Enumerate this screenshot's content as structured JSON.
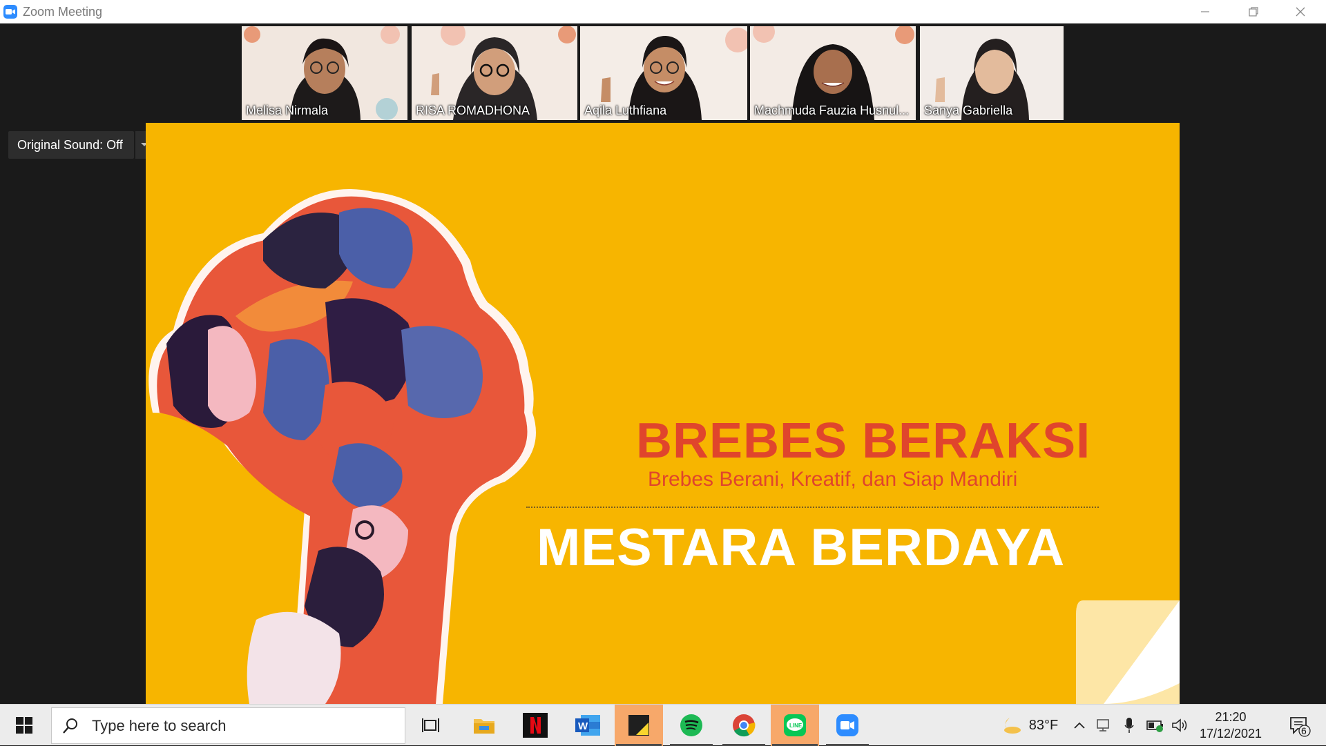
{
  "window": {
    "title": "Zoom Meeting"
  },
  "participants": [
    {
      "name": "Melisa Nirmala",
      "active": false
    },
    {
      "name": "RISA ROMADHONA",
      "active": false
    },
    {
      "name": "Aqila Luthfiana",
      "active": true
    },
    {
      "name": "Machmuda Fauzia Husnul...",
      "active": false
    },
    {
      "name": "Sanya Gabriella",
      "active": false
    }
  ],
  "audio": {
    "original_sound_label": "Original Sound: Off"
  },
  "slide": {
    "headline": "BREBES BERAKSI",
    "tagline": "Brebes Berani, Kreatif, dan Siap Mandiri",
    "program": "MESTARA BERDAYA"
  },
  "taskbar": {
    "search_placeholder": "Type here to search",
    "apps": [
      "task-view",
      "file-explorer",
      "netflix",
      "word",
      "sticky-notes",
      "spotify",
      "chrome",
      "line",
      "zoom"
    ],
    "weather": {
      "temp": "83°F"
    },
    "clock": {
      "time": "21:20",
      "date": "17/12/2021"
    },
    "notifications": {
      "count": "6"
    }
  }
}
